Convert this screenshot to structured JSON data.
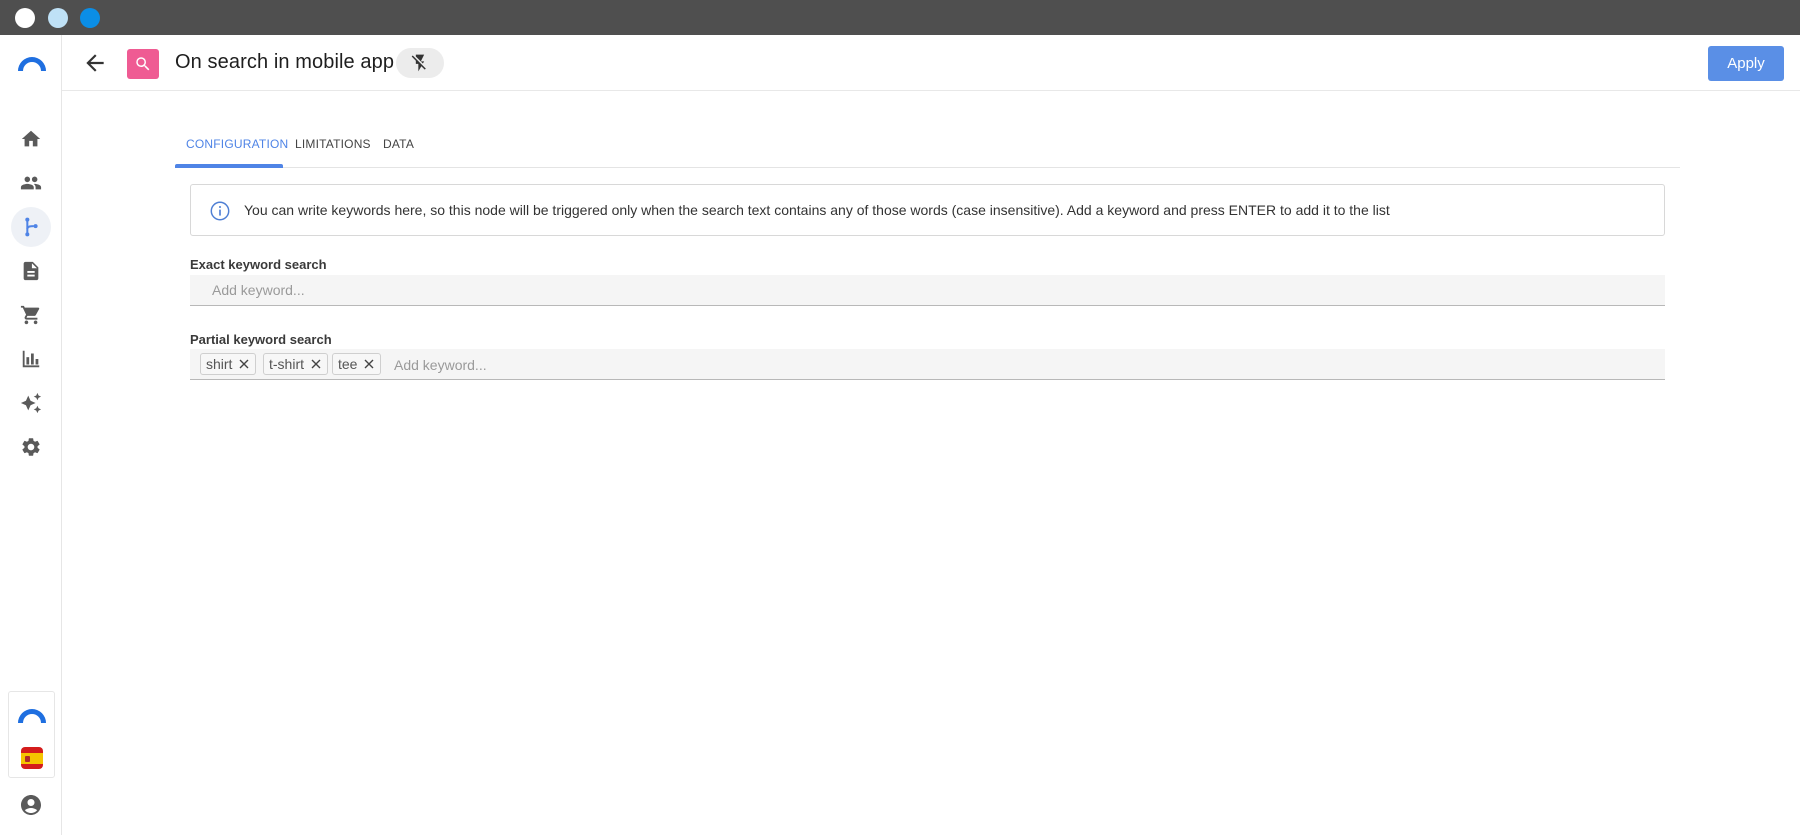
{
  "app": {
    "page_title": "On search in mobile app",
    "apply_label": "Apply"
  },
  "tabs": [
    {
      "label": "CONFIGURATION",
      "active": true
    },
    {
      "label": "LIMITATIONS",
      "active": false
    },
    {
      "label": "DATA",
      "active": false
    }
  ],
  "info": {
    "text": "You can write keywords here, so this node will be triggered only when the search text contains any of those words (case insensitive). Add a keyword and press ENTER to add it to the list"
  },
  "exact": {
    "label": "Exact keyword search",
    "placeholder": "Add keyword..."
  },
  "partial": {
    "label": "Partial keyword search",
    "placeholder": "Add keyword...",
    "chips": [
      "shirt",
      "t-shirt",
      "tee"
    ]
  },
  "sidebar": {
    "items": [
      "home-icon",
      "people-icon",
      "flow-icon",
      "document-icon",
      "cart-icon",
      "bar-chart-icon",
      "sparkles-icon",
      "gear-icon"
    ],
    "active_index": 2
  },
  "colors": {
    "accent": "#4f84e6",
    "node_icon": "#ef5b93",
    "apply_button": "#5a8fe6"
  }
}
